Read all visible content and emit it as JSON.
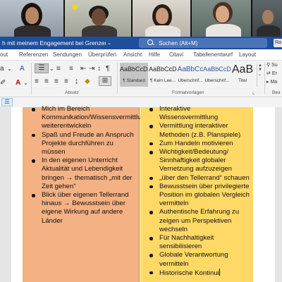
{
  "video": {
    "participants": [
      "participant-1",
      "participant-2",
      "participant-3",
      "participant-4",
      "participant-5"
    ]
  },
  "titlebar": {
    "doc_title": "h mit meinem Engagement bei Grenzenlos er...",
    "search_text": "Suchen (Alt+M)",
    "account_initials": "Ra"
  },
  "tabs": [
    "out",
    "Referenzen",
    "Sendungen",
    "Überprüfen",
    "Ansicht",
    "Hilfe",
    "Citavi",
    "Tabellenentwurf",
    "Layout"
  ],
  "ribbon": {
    "paragraph_label": "Absatz",
    "styles_label": "Formatvorlagen",
    "styles": [
      {
        "sample": "AaBbCcDc",
        "name": "¶ Standard",
        "selected": true
      },
      {
        "sample": "AaBbCcDc",
        "name": "¶ Kein Lee..."
      },
      {
        "sample": "AaBbCc",
        "name": "Überschrif..."
      },
      {
        "sample": "AaBbCcD",
        "name": "Überschrif..."
      },
      {
        "sample": "AaB",
        "name": "Titel"
      }
    ],
    "side_tools": [
      "Su",
      "Er",
      "Ma"
    ],
    "side_label": "Bea"
  },
  "table": {
    "left_items": [
      "Mich im Bereich Kommunikation/Wissensvermittlung weiterentwickeln",
      "Spaß und Freude an Anspruch Projekte durchführen zu müssen",
      "In den eigenen Unterricht Aktualität und Lebendigkeit bringen → thematisch „mit der Zeit gehen“",
      "Blick über eigenen Tellerrand hinaus → Bewusstsein über eigene Wirkung auf andere Länder"
    ],
    "right_items": [
      "Interaktive Wissensvermittlung",
      "Vermittlung interaktiver Methoden (z.B. Planspiele)",
      "Zum Handeln motivieren",
      "Wichtigkeit/Bedeutung/ Sinnhaftigkeit globaler Vernetzung aufzuzeigen",
      "„über den Tellerrand“ schauen",
      "Bewusstsein über privilegierte Position im globalen Vergleich vermitteln",
      "Authentische Erfahrung zu zeigen um Perspektiven wechseln",
      "Für Nachhaltigkeit sensibilisieren",
      "Globale Verantwortung vermitteln",
      "Historische Kontinui"
    ]
  },
  "colors": {
    "word_blue": "#1f4e9c",
    "left_column": "#f4b183",
    "right_column": "#ffd966"
  }
}
